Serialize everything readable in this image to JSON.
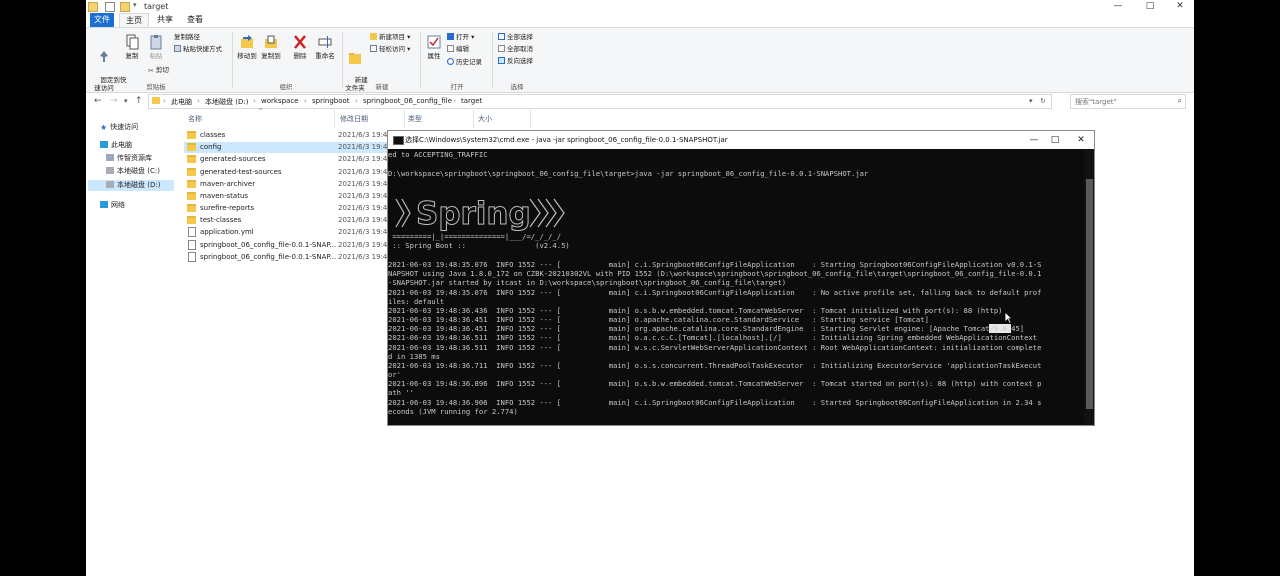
{
  "window": {
    "title": "target",
    "controls": [
      "—",
      "□",
      "✕"
    ]
  },
  "tabs": [
    "文件",
    "主页",
    "共享",
    "查看"
  ],
  "ribbon": {
    "clipboard": {
      "pin": "固定到快\n速访问",
      "copy": "复制",
      "paste": "粘贴",
      "copy_path": "复制路径",
      "paste_shortcut": "粘贴快捷方式",
      "cut": "剪切",
      "label": "剪贴板"
    },
    "organize": {
      "move_to": "移动到",
      "copy_to": "复制到",
      "delete": "删除",
      "rename": "重命名",
      "label": "组织"
    },
    "new": {
      "new_folder": "新建\n文件夹",
      "new_item": "新建项目 ▾",
      "easy_access": "轻松访问 ▾",
      "label": "新建"
    },
    "open": {
      "properties": "属性",
      "open": "打开 ▾",
      "edit": "编辑",
      "history": "历史记录",
      "label": "打开"
    },
    "select": {
      "select_all": "全部选择",
      "select_none": "全部取消",
      "invert": "反向选择",
      "label": "选择"
    }
  },
  "address": {
    "crumbs": [
      "此电脑",
      "本地磁盘 (D:)",
      "workspace",
      "springboot",
      "springboot_06_config_file",
      "target"
    ],
    "search_placeholder": "搜索\"target\""
  },
  "navpane": {
    "items": [
      {
        "label": "快速访问"
      },
      {
        "label": "此电脑"
      },
      {
        "label": "传智资源库"
      },
      {
        "label": "本地磁盘 (C:)"
      },
      {
        "label": "本地磁盘 (D:)"
      },
      {
        "label": "网络"
      }
    ]
  },
  "filelist": {
    "columns": [
      "名称",
      "修改日期",
      "类型",
      "大小"
    ],
    "rows": [
      {
        "name": "classes",
        "date": "2021/6/3 19:4"
      },
      {
        "name": "config",
        "date": "2021/6/3 19:4"
      },
      {
        "name": "generated-sources",
        "date": "2021/6/3 19:4"
      },
      {
        "name": "generated-test-sources",
        "date": "2021/6/3 19:4"
      },
      {
        "name": "maven-archiver",
        "date": "2021/6/3 19:4"
      },
      {
        "name": "maven-status",
        "date": "2021/6/3 19:4"
      },
      {
        "name": "surefire-reports",
        "date": "2021/6/3 19:4"
      },
      {
        "name": "test-classes",
        "date": "2021/6/3 19:4"
      },
      {
        "name": "application.yml",
        "date": "2021/6/3 19:4"
      },
      {
        "name": "springboot_06_config_file-0.0.1-SNAP...",
        "date": "2021/6/3 19:4"
      },
      {
        "name": "springboot_06_config_file-0.0.1-SNAP...",
        "date": "2021/6/3 19:4"
      }
    ]
  },
  "cmd": {
    "title": "选择C:\\Windows\\System32\\cmd.exe - java  -jar springboot_06_config_file-0.0.1-SNAPSHOT.jar",
    "lines": [
      "ed to ACCEPTING_TRAFFIC",
      "",
      "D:\\workspace\\springboot\\springboot_06_config_file\\target>java -jar springboot_06_config_file-0.0.1-SNAPSHOT.jar",
      "",
      "",
      "",
      "",
      "",
      " =========|_|==============|___/=/_/_/_/",
      " :: Spring Boot ::                (v2.4.5)",
      "",
      "2021-06-03 19:48:35.076  INFO 1552 --- [           main] c.i.Springboot06ConfigFileApplication    : Starting Springboot06ConfigFileApplication v0.0.1-S",
      "NAPSHOT using Java 1.8.0_172 on CZBK-20210302VL with PID 1552 (D:\\workspace\\springboot\\springboot_06_config_file\\target\\springboot_06_config_file-0.0.1",
      "-SNAPSHOT.jar started by itcast in D:\\workspace\\springboot\\springboot_06_config_file\\target)",
      "2021-06-03 19:48:35.076  INFO 1552 --- [           main] c.i.Springboot06ConfigFileApplication    : No active profile set, falling back to default prof",
      "iles: default",
      "2021-06-03 19:48:36.436  INFO 1552 --- [           main] o.s.b.w.embedded.tomcat.TomcatWebServer  : Tomcat initialized with port(s): 88 (http)",
      "2021-06-03 19:48:36.451  INFO 1552 --- [           main] o.apache.catalina.core.StandardService   : Starting service [Tomcat]",
      "2021-06-03 19:48:36.451  INFO 1552 --- [           main] org.apache.catalina.core.StandardEngine  : Starting Servlet engine: [Apache Tomcat/9.0.45]",
      "2021-06-03 19:48:36.511  INFO 1552 --- [           main] o.a.c.c.C.[Tomcat].[localhost].[/]       : Initializing Spring embedded WebApplicationContext",
      "2021-06-03 19:48:36.511  INFO 1552 --- [           main] w.s.c.ServletWebServerApplicationContext : Root WebApplicationContext: initialization complete",
      "d in 1385 ms",
      "2021-06-03 19:48:36.711  INFO 1552 --- [           main] o.s.s.concurrent.ThreadPoolTaskExecutor  : Initializing ExecutorService 'applicationTaskExecut",
      "or'",
      "2021-06-03 19:48:36.896  INFO 1552 --- [           main] o.s.b.w.embedded.tomcat.TomcatWebServer  : Tomcat started on port(s): 88 (http) with context p",
      "ath ''",
      "2021-06-03 19:48:36.906  INFO 1552 --- [           main] c.i.Springboot06ConfigFileApplication    : Started Springboot06ConfigFileApplication in 2.34 s",
      "econds (JVM running for 2.774)"
    ]
  }
}
